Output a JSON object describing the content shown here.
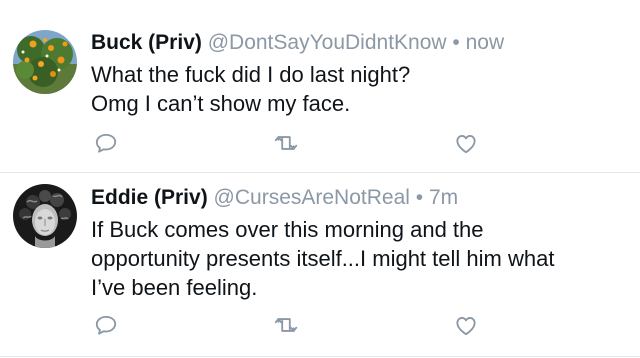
{
  "colors": {
    "text": "#0f1419",
    "secondary": "#8b98a5",
    "divider": "#e1e8ed",
    "icon": "#8b98a5"
  },
  "tweets": [
    {
      "name": "Buck (Priv)",
      "handle": "@DontSayYouDidntKnow",
      "separator": "•",
      "time": "now",
      "lines": [
        "What the fuck did I do last night?",
        "Omg I can’t show my face."
      ],
      "avatar": "orange-blossom-tree-avatar",
      "icons": {
        "reply": "reply-icon",
        "retweet": "retweet-icon",
        "like": "like-icon"
      }
    },
    {
      "name": "Eddie (Priv)",
      "handle": "@CursesAreNotReal",
      "separator": "•",
      "time": "7m",
      "lines": [
        "If Buck comes over this morning and the",
        "opportunity presents itself...I might tell him what",
        "I’ve been feeling."
      ],
      "avatar": "medusa-statue-avatar",
      "icons": {
        "reply": "reply-icon",
        "retweet": "retweet-icon",
        "like": "like-icon"
      }
    }
  ]
}
